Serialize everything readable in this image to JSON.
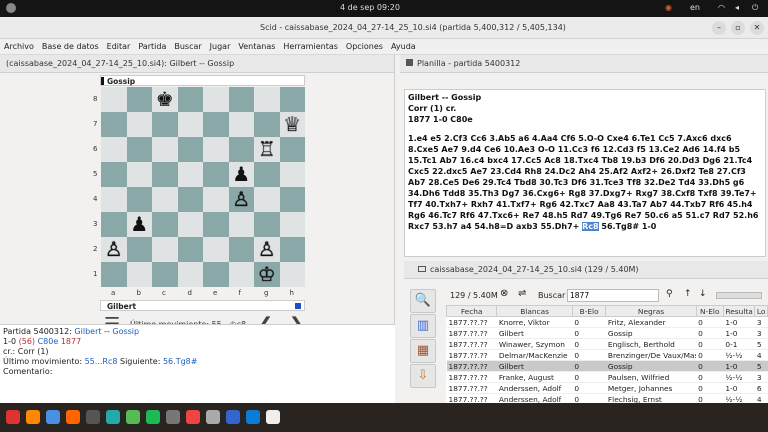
{
  "system": {
    "date_time": "4 de sep  09:20",
    "language": "en"
  },
  "window": {
    "title": "Scid - caissabase_2024_04_27-14_25_10.si4 (partida 5,400,312 / 5,405,134)"
  },
  "menu": [
    "Archivo",
    "Base de datos",
    "Editar",
    "Partida",
    "Buscar",
    "Jugar",
    "Ventanas",
    "Herramientas",
    "Opciones",
    "Ayuda"
  ],
  "board_pane": {
    "header": "(caissabase_2024_04_27-14_25_10.si4): Gilbert -- Gossip",
    "top_player": "Gossip",
    "bottom_player": "Gilbert",
    "files": [
      "a",
      "b",
      "c",
      "d",
      "e",
      "f",
      "g",
      "h"
    ],
    "ranks": [
      "8",
      "7",
      "6",
      "5",
      "4",
      "3",
      "2",
      "1"
    ],
    "last_move_label": "Último movimiento: 55...♔c8",
    "prev_icon": "❮",
    "next_icon": "❯",
    "menu_icon": "☰"
  },
  "pieces": [
    {
      "glyph": "♚",
      "sq": "c8",
      "color": "black"
    },
    {
      "glyph": "♕",
      "sq": "h7",
      "color": "white"
    },
    {
      "glyph": "♖",
      "sq": "g6",
      "color": "white"
    },
    {
      "glyph": "♟",
      "sq": "f5",
      "color": "black"
    },
    {
      "glyph": "♙",
      "sq": "f4",
      "color": "white"
    },
    {
      "glyph": "♟",
      "sq": "b3",
      "color": "black"
    },
    {
      "glyph": "♙",
      "sq": "a2",
      "color": "white"
    },
    {
      "glyph": "♙",
      "sq": "g2",
      "color": "white"
    },
    {
      "glyph": "♔",
      "sq": "g1",
      "color": "white"
    }
  ],
  "info": {
    "line1_prefix": "Partida 5400312:",
    "white": "Gilbert",
    "sep": "--",
    "black": "Gossip",
    "result": "1-0",
    "plies": "(56)",
    "eco": "C80e",
    "year": "1877",
    "event": "cr.:  Corr (1)",
    "last_move_prefix": "Último movimiento:",
    "last_move": "55...Rc8",
    "next_prefix": "Siguiente:",
    "next_move": "56.Tg8#",
    "comment": "Comentario:"
  },
  "notation": {
    "tab": "Planilla - partida 5400312",
    "header1": "Gilbert  --  Gossip",
    "header2": "Corr (1)  cr.",
    "header3": "1877  1-0  C80e",
    "moves": "1.e4 e5 2.Cf3 Cc6 3.Ab5 a6 4.Aa4 Cf6 5.O-O Cxe4 6.Te1 Cc5 7.Axc6 dxc6 8.Cxe5 Ae7 9.d4 Ce6 10.Ae3 O-O 11.Cc3 f6 12.Cd3 f5 13.Ce2 Ad6 14.f4 b5 15.Tc1 Ab7 16.c4 bxc4 17.Cc5 Ac8 18.Txc4 Tb8 19.b3 Df6 20.Dd3 Dg6 21.Tc4 Cxc5 22.dxc5 Ae7 23.Cd4 Rh8 24.Dc2 Ah4 25.Af2 Axf2+ 26.Dxf2 Te8 27.Cf3 Ab7 28.Ce5 De6 29.Tc4 Tbd8 30.Tc3 Df6 31.Tce3 Tf8 32.De2 Td4 33.Dh5 g6 34.Dh6 Tdd8 35.Th3 Dg7 36.Cxg6+ Rg8 37.Dxg7+ Rxg7 38.Cxf8 Txf8 39.Te7+ Tf7 40.Txh7+ Rxh7 41.Txf7+ Rg6 42.Txc7 Aa8 43.Ta7 Ab7 44.Txb7 Rf6 45.h4 Rg6 46.Tc7 Rf6 47.Txc6+ Re7 48.h5 Rd7 49.Tg6 Re7 50.c6 a5 51.c7 Rd7 52.h6 Rxc7 53.h7 a4 54.h8=D axb3 55.Dh7+",
    "highlight": "Rc8",
    "tail": "56.Tg8# 1-0"
  },
  "database": {
    "tab": "caissabase_2024_04_27-14_25_10.si4 (129 / 5.40M)",
    "count": "129 / 5.40M",
    "search_label": "Buscar",
    "search_value": "1877",
    "columns": [
      "Fecha",
      "Blancas",
      "B-Elo",
      "Negras",
      "N-Elo",
      "Resulta",
      "Lo"
    ],
    "rows": [
      [
        "1877.??.??",
        "Knorre, Viktor",
        "0",
        "Fritz, Alexander",
        "0",
        "1-0",
        "3"
      ],
      [
        "1877.??.??",
        "Gilbert",
        "0",
        "Gossip",
        "0",
        "1-0",
        "3"
      ],
      [
        "1877.??.??",
        "Winawer, Szymon",
        "0",
        "Englisch, Berthold",
        "0",
        "0-1",
        "5"
      ],
      [
        "1877.??.??",
        "Delmar/MacKenzie",
        "0",
        "Brenzinger/De Vaux/Maso",
        "0",
        "½-½",
        "4"
      ],
      [
        "1877.??.??",
        "Gilbert",
        "0",
        "Gossip",
        "0",
        "1-0",
        "5"
      ],
      [
        "1877.??.??",
        "Franke, August",
        "0",
        "Paulsen, Wilfried",
        "0",
        "½-½",
        "3"
      ],
      [
        "1877.??.??",
        "Anderssen, Adolf",
        "0",
        "Metger, Johannes",
        "0",
        "1-0",
        "6"
      ],
      [
        "1877.??.??",
        "Anderssen, Adolf",
        "0",
        "Flechsig, Ernst",
        "0",
        "½-½",
        "4"
      ],
      [
        "1877.??.??",
        "Flechsig, Ernst",
        "0",
        "Winawer, Szymon",
        "0",
        "½-½",
        "4"
      ]
    ],
    "selected_row": 4
  }
}
